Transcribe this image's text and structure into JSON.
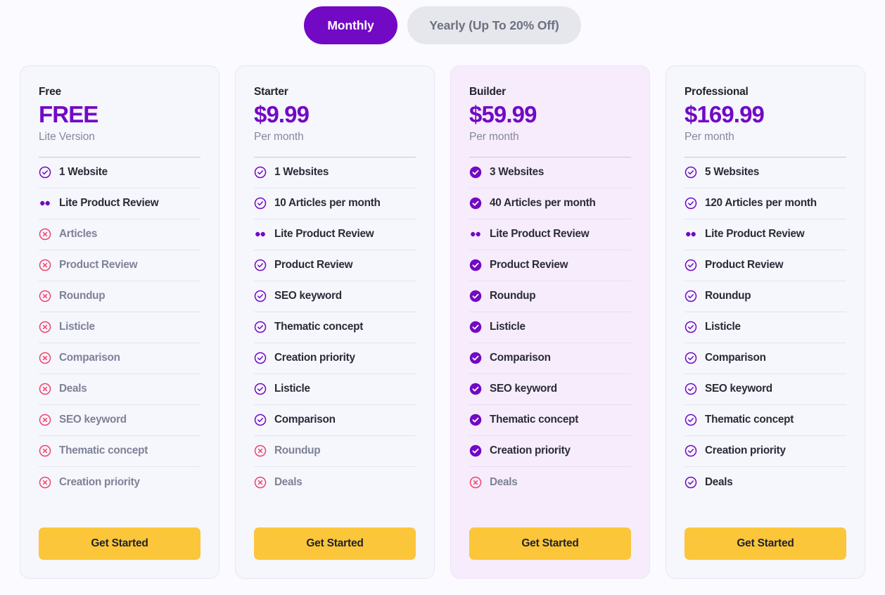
{
  "billing_toggle": {
    "options": [
      {
        "label": "Monthly",
        "selected": true
      },
      {
        "label": "Yearly (Up To 20% Off)",
        "selected": false
      }
    ]
  },
  "colors": {
    "accent_purple": "#7209c4",
    "cta_yellow": "#fbc63a",
    "deny_red": "#f0436b",
    "page_background": "#fafaff",
    "card_background": "#f6f6fd",
    "featured_card_background": "#f6ecfc"
  },
  "cta_label": "Get Started",
  "plans": [
    {
      "name": "Free",
      "price": "FREE",
      "period": "Lite Version",
      "featured": false,
      "cta_label": "Get Started",
      "features": [
        {
          "label": "1 Website",
          "icon": "check-circle-outline-icon",
          "state": "on"
        },
        {
          "label": "Lite Product Review",
          "icon": "infinity-icon",
          "state": "on"
        },
        {
          "label": "Articles",
          "icon": "x-circle-outline-icon",
          "state": "off"
        },
        {
          "label": "Product Review",
          "icon": "x-circle-outline-icon",
          "state": "off"
        },
        {
          "label": "Roundup",
          "icon": "x-circle-outline-icon",
          "state": "off"
        },
        {
          "label": "Listicle",
          "icon": "x-circle-outline-icon",
          "state": "off"
        },
        {
          "label": "Comparison",
          "icon": "x-circle-outline-icon",
          "state": "off"
        },
        {
          "label": "Deals",
          "icon": "x-circle-outline-icon",
          "state": "off"
        },
        {
          "label": "SEO keyword",
          "icon": "x-circle-outline-icon",
          "state": "off"
        },
        {
          "label": "Thematic concept",
          "icon": "x-circle-outline-icon",
          "state": "off"
        },
        {
          "label": "Creation priority",
          "icon": "x-circle-outline-icon",
          "state": "off"
        }
      ]
    },
    {
      "name": "Starter",
      "price": "$9.99",
      "period": "Per month",
      "featured": false,
      "cta_label": "Get Started",
      "features": [
        {
          "label": "1 Websites",
          "icon": "check-circle-outline-icon",
          "state": "on"
        },
        {
          "label": "10 Articles per month",
          "icon": "check-circle-outline-icon",
          "state": "on"
        },
        {
          "label": "Lite Product Review",
          "icon": "infinity-icon",
          "state": "on"
        },
        {
          "label": "Product Review",
          "icon": "check-circle-outline-icon",
          "state": "on"
        },
        {
          "label": "SEO keyword",
          "icon": "check-circle-outline-icon",
          "state": "on"
        },
        {
          "label": "Thematic concept",
          "icon": "check-circle-outline-icon",
          "state": "on"
        },
        {
          "label": "Creation priority",
          "icon": "check-circle-outline-icon",
          "state": "on"
        },
        {
          "label": "Listicle",
          "icon": "check-circle-outline-icon",
          "state": "on"
        },
        {
          "label": "Comparison",
          "icon": "check-circle-outline-icon",
          "state": "on"
        },
        {
          "label": "Roundup",
          "icon": "x-circle-outline-icon",
          "state": "off"
        },
        {
          "label": "Deals",
          "icon": "x-circle-outline-icon",
          "state": "off"
        }
      ]
    },
    {
      "name": "Builder",
      "price": "$59.99",
      "period": "Per month",
      "featured": true,
      "cta_label": "Get Started",
      "features": [
        {
          "label": "3 Websites",
          "icon": "check-circle-filled-icon",
          "state": "on"
        },
        {
          "label": "40 Articles per month",
          "icon": "check-circle-filled-icon",
          "state": "on"
        },
        {
          "label": "Lite Product Review",
          "icon": "infinity-icon",
          "state": "on"
        },
        {
          "label": "Product Review",
          "icon": "check-circle-filled-icon",
          "state": "on"
        },
        {
          "label": "Roundup",
          "icon": "check-circle-filled-icon",
          "state": "on"
        },
        {
          "label": "Listicle",
          "icon": "check-circle-filled-icon",
          "state": "on"
        },
        {
          "label": "Comparison",
          "icon": "check-circle-filled-icon",
          "state": "on"
        },
        {
          "label": "SEO keyword",
          "icon": "check-circle-filled-icon",
          "state": "on"
        },
        {
          "label": "Thematic concept",
          "icon": "check-circle-filled-icon",
          "state": "on"
        },
        {
          "label": "Creation priority",
          "icon": "check-circle-filled-icon",
          "state": "on"
        },
        {
          "label": "Deals",
          "icon": "x-circle-outline-icon",
          "state": "off"
        }
      ]
    },
    {
      "name": "Professional",
      "price": "$169.99",
      "period": "Per month",
      "featured": false,
      "cta_label": "Get Started",
      "features": [
        {
          "label": "5 Websites",
          "icon": "check-circle-outline-icon",
          "state": "on"
        },
        {
          "label": "120 Articles per month",
          "icon": "check-circle-outline-icon",
          "state": "on"
        },
        {
          "label": "Lite Product Review",
          "icon": "infinity-icon",
          "state": "on"
        },
        {
          "label": "Product Review",
          "icon": "check-circle-outline-icon",
          "state": "on"
        },
        {
          "label": "Roundup",
          "icon": "check-circle-outline-icon",
          "state": "on"
        },
        {
          "label": "Listicle",
          "icon": "check-circle-outline-icon",
          "state": "on"
        },
        {
          "label": "Comparison",
          "icon": "check-circle-outline-icon",
          "state": "on"
        },
        {
          "label": "SEO keyword",
          "icon": "check-circle-outline-icon",
          "state": "on"
        },
        {
          "label": "Thematic concept",
          "icon": "check-circle-outline-icon",
          "state": "on"
        },
        {
          "label": "Creation priority",
          "icon": "check-circle-outline-icon",
          "state": "on"
        },
        {
          "label": "Deals",
          "icon": "check-circle-outline-icon",
          "state": "on"
        }
      ]
    }
  ]
}
